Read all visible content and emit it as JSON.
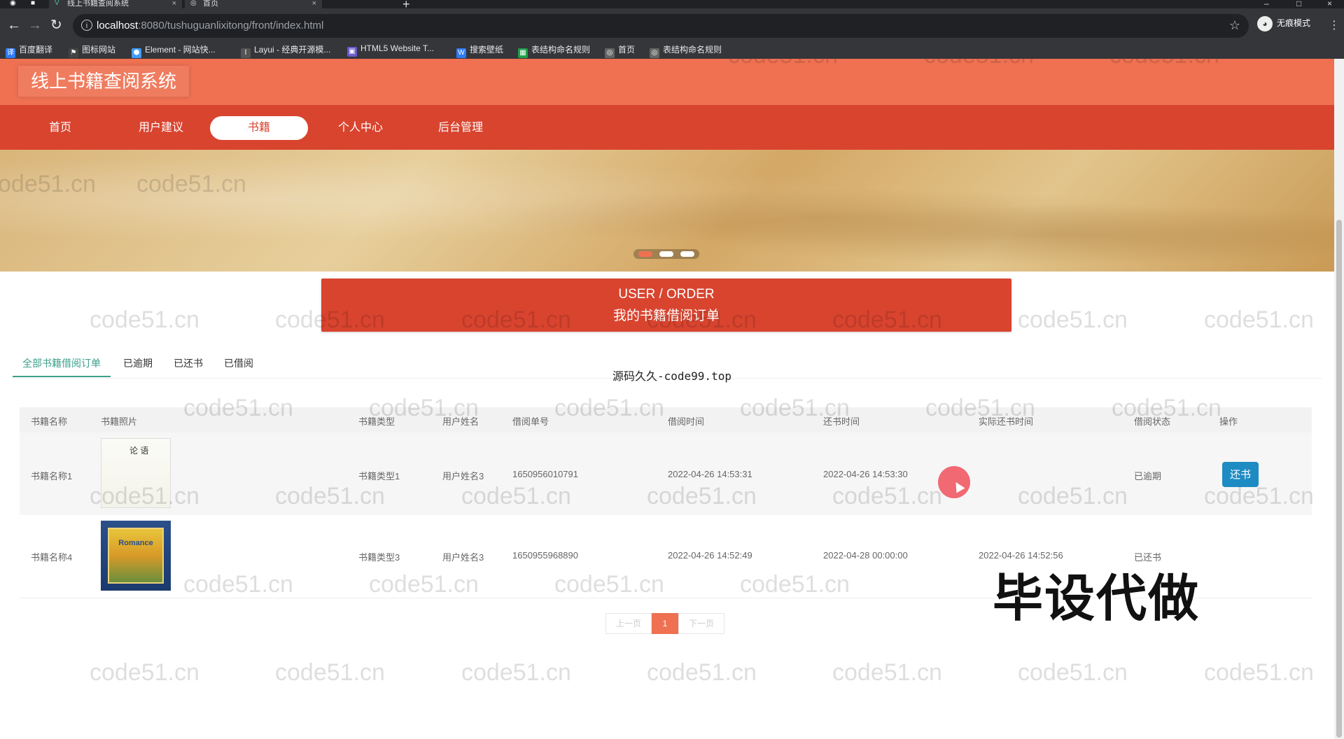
{
  "browser": {
    "tabs": [
      {
        "title": "线上书籍查阅系统",
        "close": "×"
      },
      {
        "title": "首页",
        "close": "×"
      }
    ],
    "new_tab": "+",
    "url_host": "localhost",
    "url_rest": ":8080/tushuguanlixitong/front/index.html",
    "incognito_label": "无痕模式",
    "bookmarks": [
      {
        "label": "百度翻译",
        "color": "#2f7cf6"
      },
      {
        "label": "图标网站",
        "color": "#444444"
      },
      {
        "label": "Element - 网站快...",
        "color": "#409eff"
      },
      {
        "label": "Layui - 经典开源模...",
        "color": "#555555"
      },
      {
        "label": "HTML5 Website T...",
        "color": "#6a5acd"
      },
      {
        "label": "搜索壁纸",
        "color": "#2f7cf6"
      },
      {
        "label": "表结构命名规则",
        "color": "#1e9e4a"
      },
      {
        "label": "首页",
        "color": "#666666"
      },
      {
        "label": "表结构命名规则",
        "color": "#666666"
      }
    ]
  },
  "site": {
    "title": "线上书籍查阅系统",
    "nav": [
      "首页",
      "用户建议",
      "书籍",
      "个人中心",
      "后台管理"
    ],
    "active_nav": "书籍"
  },
  "section": {
    "title_en": "USER / ORDER",
    "title_zh": "我的书籍借阅订单"
  },
  "tabs": [
    "全部书籍借阅订单",
    "已逾期",
    "已还书",
    "已借阅"
  ],
  "source_note": "源码久久-code99.top",
  "table": {
    "headers": [
      "书籍名称",
      "书籍照片",
      "书籍类型",
      "用户姓名",
      "借阅单号",
      "借阅时间",
      "还书时间",
      "实际还书时间",
      "借阅状态",
      "操作"
    ],
    "rows": [
      {
        "name": "书籍名称1",
        "photo_title": "论 语",
        "type": "书籍类型1",
        "user": "用户姓名3",
        "order_no": "1650956010791",
        "borrow_time": "2022-04-26 14:53:31",
        "return_time": "2022-04-26 14:53:30",
        "actual_return": "",
        "status": "已逾期",
        "action": "还书"
      },
      {
        "name": "书籍名称4",
        "photo_title": "Romance",
        "type": "书籍类型3",
        "user": "用户姓名3",
        "order_no": "1650955968890",
        "borrow_time": "2022-04-26 14:52:49",
        "return_time": "2022-04-28 00:00:00",
        "actual_return": "2022-04-26 14:52:56",
        "status": "已还书",
        "action": ""
      }
    ]
  },
  "pager": {
    "prev": "上一页",
    "current": "1",
    "next": "下一页"
  },
  "overlay": "毕设代做",
  "watermark": "code51.cn",
  "colors": {
    "header": "#ef7152",
    "nav": "#d9442f",
    "tab_active": "#3aa08a",
    "button": "#1e8bc3"
  }
}
